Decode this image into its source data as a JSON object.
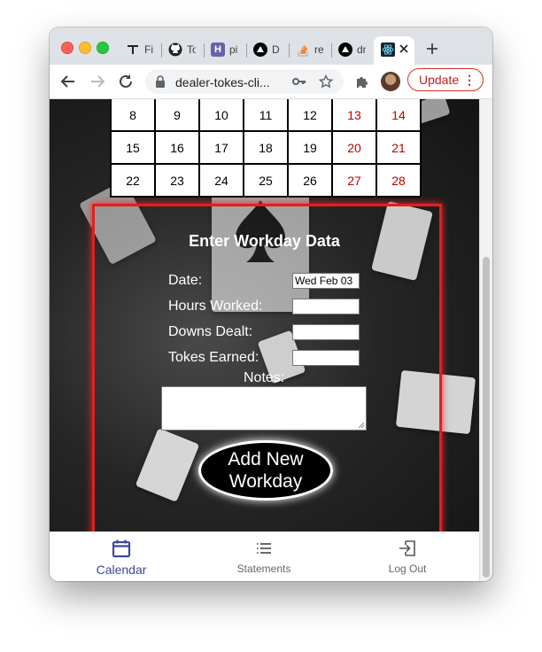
{
  "browser": {
    "tabs": [
      {
        "icon": "typora-icon",
        "label": "Fi"
      },
      {
        "icon": "github-icon",
        "label": "To"
      },
      {
        "icon": "heroku-icon",
        "label": "pi"
      },
      {
        "icon": "vercel-icon",
        "label": "D"
      },
      {
        "icon": "stackoverflow-icon",
        "label": "re"
      },
      {
        "icon": "vercel-icon",
        "label": "dr"
      }
    ],
    "active_tab_icon": "react-icon",
    "url": "dealer-tokes-cli...",
    "update_label": "Update"
  },
  "calendar": {
    "rows": [
      [
        "8",
        "9",
        "10",
        "11",
        "12",
        "13",
        "14"
      ],
      [
        "15",
        "16",
        "17",
        "18",
        "19",
        "20",
        "21"
      ],
      [
        "22",
        "23",
        "24",
        "25",
        "26",
        "27",
        "28"
      ]
    ],
    "weekend_color": "#c00000"
  },
  "form": {
    "title": "Enter Workday Data",
    "date_label": "Date:",
    "date_value": "Wed Feb 03",
    "hours_label": "Hours Worked:",
    "downs_label": "Downs Dealt:",
    "tokes_label": "Tokes Earned:",
    "notes_label": "Notes:",
    "add_button_line1": "Add New",
    "add_button_line2": "Workday",
    "border_color": "#e02020"
  },
  "bottom_nav": {
    "items": [
      {
        "label": "Calendar",
        "icon": "calendar-icon",
        "active": true
      },
      {
        "label": "Statements",
        "icon": "list-icon",
        "active": false
      },
      {
        "label": "Log Out",
        "icon": "logout-icon",
        "active": false
      }
    ],
    "active_color": "#3b4a9a"
  }
}
